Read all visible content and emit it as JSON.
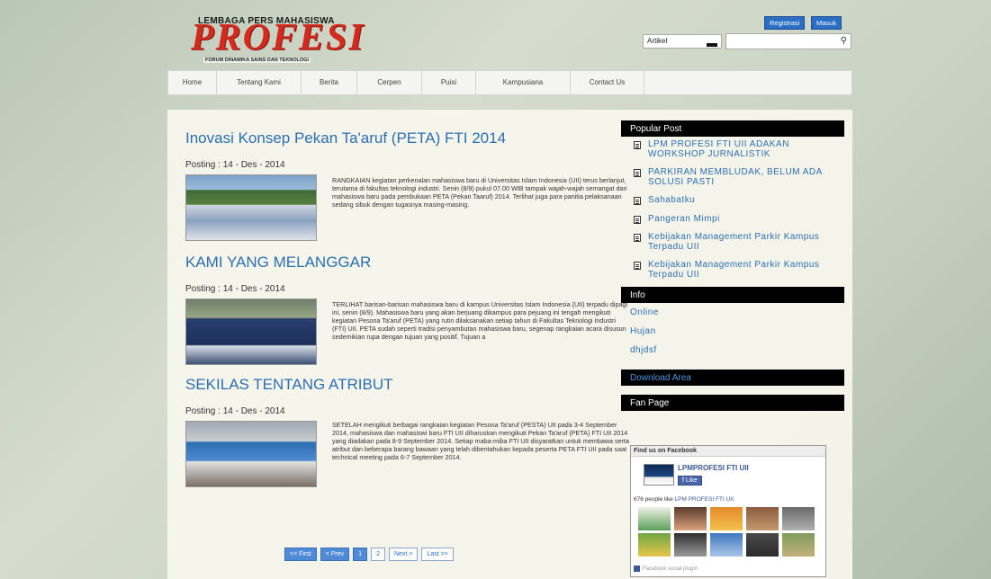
{
  "header": {
    "logo_top": "LEMBAGA PERS MAHASISWA",
    "logo_main": "PROFESI",
    "logo_sub": "FORUM DINAMIKA SAINS DAN TEKNOLOGI",
    "registrasi_label": "Registrasi",
    "masuk_label": "Masuk",
    "search_category": "Artikel",
    "search_value": ""
  },
  "nav": [
    "Home",
    "Tentang Kami",
    "Berita",
    "Cerpen",
    "Puisi",
    "Kampusiana",
    "Contact Us"
  ],
  "articles": [
    {
      "title": "Inovasi Konsep Pekan Ta'aruf (PETA) FTI 2014",
      "date": "Posting : 14 - Des - 2014",
      "excerpt": "RANGKAIAN kegiatan perkenalan mahasiswa baru di Universitas Islam Indonesia (UII) terus berlanjut, terutama di fakultas teknologi industri. Senin (8/9) pukul 07.00 WIB tampak wajah-wajah semangat dari mahasiswa baru pada pembukaan PETA (Pekan Taaruf) 2014. Terlihat juga para panitia pelaksanaan sedang sibuk dengan tugasnya masing-masing."
    },
    {
      "title": "KAMI YANG MELANGGAR",
      "date": "Posting : 14 - Des - 2014",
      "excerpt": "TERLIHAT barisan-barisan mahasiswa baru di kampus Universitas Islam Indonesia (UII) terpadu dipagi ini, senin (8/9). Mahasiswa baru yang akan berjuang dikampus para pejuang ini tengah mengikuti kegiatan Pesona Ta'aruf (PETA) yang rutin dilaksanakan setiap tahun di Fakultas Teknologi Industri (FTI) UII. PETA sudah seperti tradisi penyambutan mahasiswa baru, segenap rangkaian acara disusun sedemikian rupa dengan tujuan yang positif. Tujuan a"
    },
    {
      "title": "SEKILAS TENTANG ATRIBUT",
      "date": "Posting : 14 - Des - 2014",
      "excerpt": "SETELAH mengikuti berbagai rangkaian kegiatan Pesona Ta'aruf (PESTA) UII pada 3-4 September 2014, mahasiswa dan mahasiswi baru FTI UII diharuskan mengikuti Pekan Ta'aruf (PETA) FTI UII 2014 yang diadakan pada 8-9 September 2014. Setiap maba-miba FTI UII disyaratkan untuk membawa serta atribut dan beberapa barang bawaan yang telah dibentahukan kepada peserta PETA FTI UII pada saat technical meeting pada 6-7 September 2014."
    }
  ],
  "pager": {
    "first": "<< First",
    "prev": "< Prev",
    "p1": "1",
    "p2": "2",
    "next": "Next >",
    "last": "Last >>"
  },
  "sidebar": {
    "popular_title": "Popular Post",
    "popular": [
      "LPM PROFESI FTI UII ADAKAN WORKSHOP JURNALISTIK",
      "PARKIRAN MEMBLUDAK, BELUM ADA SOLUSI PASTI",
      "Sahabatku",
      "Pangeran Mimpi",
      "Kebijakan Management Parkir Kampus Terpadu UII",
      "Kebijakan Management Parkir Kampus Terpadu UII"
    ],
    "info_title": "Info",
    "info": [
      "Online",
      "Hujan",
      "dhjdsf"
    ],
    "download_title": "Download Area",
    "fanpage_title": "Fan Page",
    "fb": {
      "find_us": "Find us on Facebook",
      "page_name": "LPMPROFESI FTI UII",
      "like": "Like",
      "count_prefix": "676 people like",
      "count_link": "LPM PROFESI FTI UII.",
      "footer": "Facebook social plugin"
    }
  },
  "colors": {
    "accent_blue": "#2b6fb0",
    "logo_red": "#d42a1e",
    "sidebar_head": "#000000"
  }
}
